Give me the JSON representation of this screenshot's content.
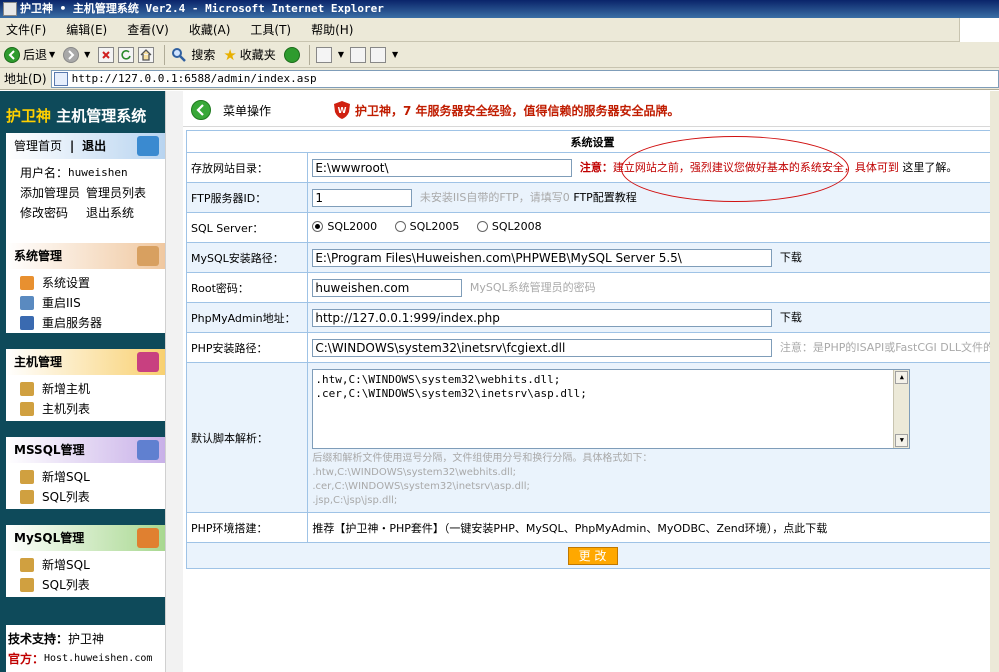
{
  "window": {
    "title": "护卫神 • 主机管理系统 Ver2.4 - Microsoft Internet Explorer"
  },
  "menu": {
    "items": [
      "文件(F)",
      "编辑(E)",
      "查看(V)",
      "收藏(A)",
      "工具(T)",
      "帮助(H)"
    ]
  },
  "toolbar": {
    "back_label": "后退",
    "search_label": "搜索",
    "favorites_label": "收藏夹"
  },
  "address": {
    "label": "地址(D)",
    "url": "http://127.0.0.1:6588/admin/index.asp"
  },
  "sidebar": {
    "brand_part1": "护卫神",
    "brand_part2": "主机管理系统",
    "account": {
      "home": "管理首页",
      "divider": "|",
      "logout": "退出",
      "username_label": "用户名：",
      "username": "huweishen",
      "add_admin": "添加管理员",
      "admin_list": "管理员列表",
      "change_password": "修改密码",
      "exit": "退出系统"
    },
    "system": {
      "title": "系统管理",
      "items": [
        "系统设置",
        "重启IIS",
        "重启服务器"
      ]
    },
    "host": {
      "title": "主机管理",
      "items": [
        "新增主机",
        "主机列表"
      ]
    },
    "mssql": {
      "title": "MSSQL管理",
      "items": [
        "新增SQL",
        "SQL列表"
      ]
    },
    "mysql": {
      "title": "MySQL管理",
      "items": [
        "新增SQL",
        "SQL列表"
      ]
    },
    "support": {
      "label": "技术支持：",
      "value": "护卫神",
      "official_label": "官方：",
      "official_value": "Host.huweishen.com"
    }
  },
  "main": {
    "menu_op": "菜单操作",
    "slogan": "护卫神，7 年服务器安全经验，值得信赖的服务器安全品牌。",
    "section_title": "系统设置",
    "rows": {
      "site_dir": {
        "label": "存放网站目录：",
        "value": "E:\\wwwroot\\",
        "note_prefix": "注意：",
        "note_red": "建立网站之前，强烈建议您做好基本的系统安全，具体可到",
        "note_link": "这里了解。"
      },
      "ftp": {
        "label": "FTP服务器ID：",
        "value": "1",
        "hint": "未安装IIS自带的FTP，请填写0",
        "link": "FTP配置教程"
      },
      "sql": {
        "label": "SQL Server：",
        "options": [
          "SQL2000",
          "SQL2005",
          "SQL2008"
        ],
        "selected": "SQL2000"
      },
      "mysql_path": {
        "label": "MySQL安装路径：",
        "value": "E:\\Program Files\\Huweishen.com\\PHPWEB\\MySQL Server 5.5\\",
        "link": "下载"
      },
      "root_pwd": {
        "label": "Root密码：",
        "value": "huweishen.com",
        "hint": "MySQL系统管理员的密码"
      },
      "phpmyadmin": {
        "label": "PhpMyAdmin地址：",
        "value": "http://127.0.0.1:999/index.php",
        "link": "下载"
      },
      "php_path": {
        "label": "PHP安装路径：",
        "value": "C:\\WINDOWS\\system32\\inetsrv\\fcgiext.dll",
        "hint": "注意：是PHP的ISAPI或FastCGI DLL文件的"
      },
      "script_map": {
        "label": "默认脚本解析：",
        "lines": [
          ".htw,C:\\WINDOWS\\system32\\webhits.dll;",
          ".cer,C:\\WINDOWS\\system32\\inetsrv\\asp.dll;"
        ],
        "help": [
          "后缀和解析文件使用逗号分隔，文件组使用分号和换行分隔。具体格式如下：",
          ".htw,C:\\WINDOWS\\system32\\webhits.dll;",
          ".cer,C:\\WINDOWS\\system32\\inetsrv\\asp.dll;",
          ".jsp,C:\\jsp\\jsp.dll;"
        ]
      },
      "php_env": {
        "label": "PHP环境搭建：",
        "text": "推荐【护卫神・PHP套件】（一键安装PHP、MySQL、PhpMyAdmin、MyODBC、Zend环境），点此下载"
      }
    },
    "save_label": "更 改"
  }
}
